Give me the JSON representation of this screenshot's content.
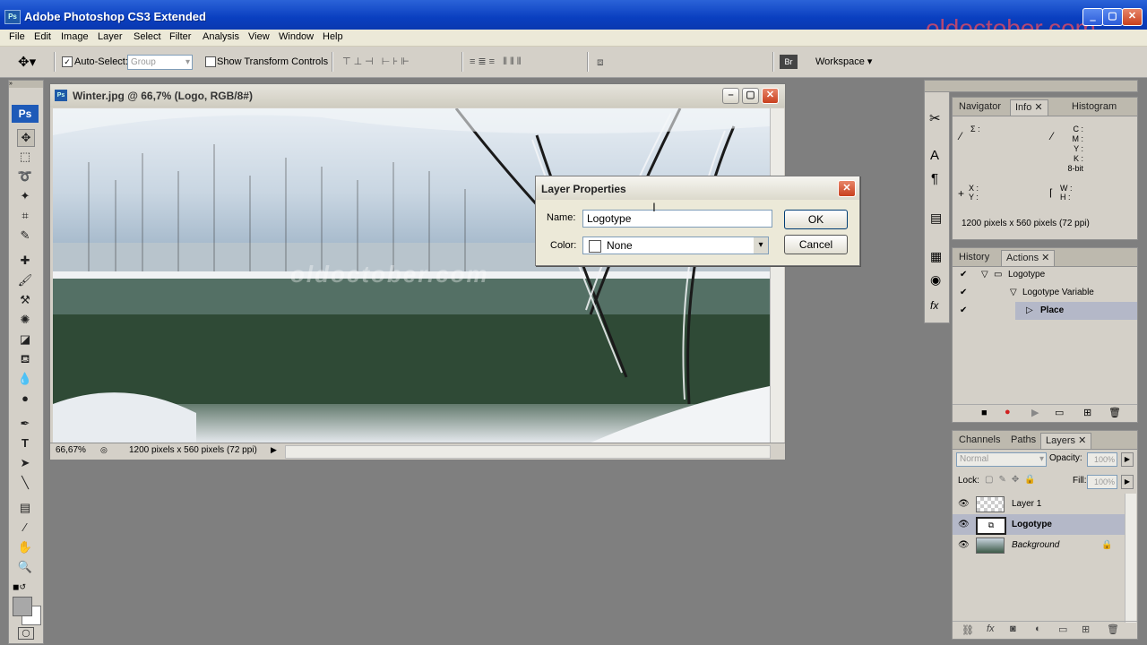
{
  "app": {
    "title": "Adobe Photoshop CS3 Extended",
    "watermark": "oldoctober.com",
    "ps_badge": "Ps"
  },
  "menu": [
    "File",
    "Edit",
    "Image",
    "Layer",
    "Select",
    "Filter",
    "Analysis",
    "View",
    "Window",
    "Help"
  ],
  "options": {
    "auto_select_label": "Auto-Select:",
    "auto_select_checked": true,
    "auto_select_value": "Group",
    "transform_label": "Show Transform Controls",
    "workspace_label": "Workspace"
  },
  "document": {
    "title": "Winter.jpg @ 66,7% (Logo, RGB/8#)",
    "image_watermark": "oldoctober.com",
    "zoom": "66,67%",
    "status": "1200 pixels x 560 pixels (72 ppi)"
  },
  "dialog": {
    "title": "Layer Properties",
    "name_label": "Name:",
    "name_value": "Logotype",
    "color_label": "Color:",
    "color_value": "None",
    "ok_label": "OK",
    "cancel_label": "Cancel"
  },
  "info_panel": {
    "tabs": [
      "Navigator",
      "Info",
      "Histogram"
    ],
    "active_tab": "Info",
    "sigma": "Σ :",
    "cmyk": [
      "C :",
      "M :",
      "Y :",
      "K :"
    ],
    "bit_depth": "8-bit",
    "xy": [
      "X :",
      "Y :"
    ],
    "wh": [
      "W :",
      "H :"
    ],
    "doc_size": "1200 pixels x 560 pixels (72 ppi)"
  },
  "actions_panel": {
    "tabs": [
      "History",
      "Actions"
    ],
    "active_tab": "Actions",
    "items": [
      {
        "label": "Logotype",
        "level": 0,
        "type": "set"
      },
      {
        "label": "Logotype Variable",
        "level": 1,
        "type": "action"
      },
      {
        "label": "Place",
        "level": 2,
        "type": "step",
        "selected": true
      }
    ]
  },
  "layers_panel": {
    "tabs": [
      "Channels",
      "Paths",
      "Layers"
    ],
    "active_tab": "Layers",
    "blend_mode": "Normal",
    "opacity_label": "Opacity:",
    "opacity_value": "100%",
    "lock_label": "Lock:",
    "fill_label": "Fill:",
    "fill_value": "100%",
    "layers": [
      {
        "name": "Layer 1",
        "selected": false,
        "locked": false
      },
      {
        "name": "Logotype",
        "selected": true,
        "locked": false
      },
      {
        "name": "Background",
        "selected": false,
        "locked": true
      }
    ]
  },
  "colors": {
    "titlebar": "#0a3fc0",
    "panel": "#d4d0c8",
    "workspace": "#7f7f7f",
    "selection": "#b4b8c8"
  }
}
